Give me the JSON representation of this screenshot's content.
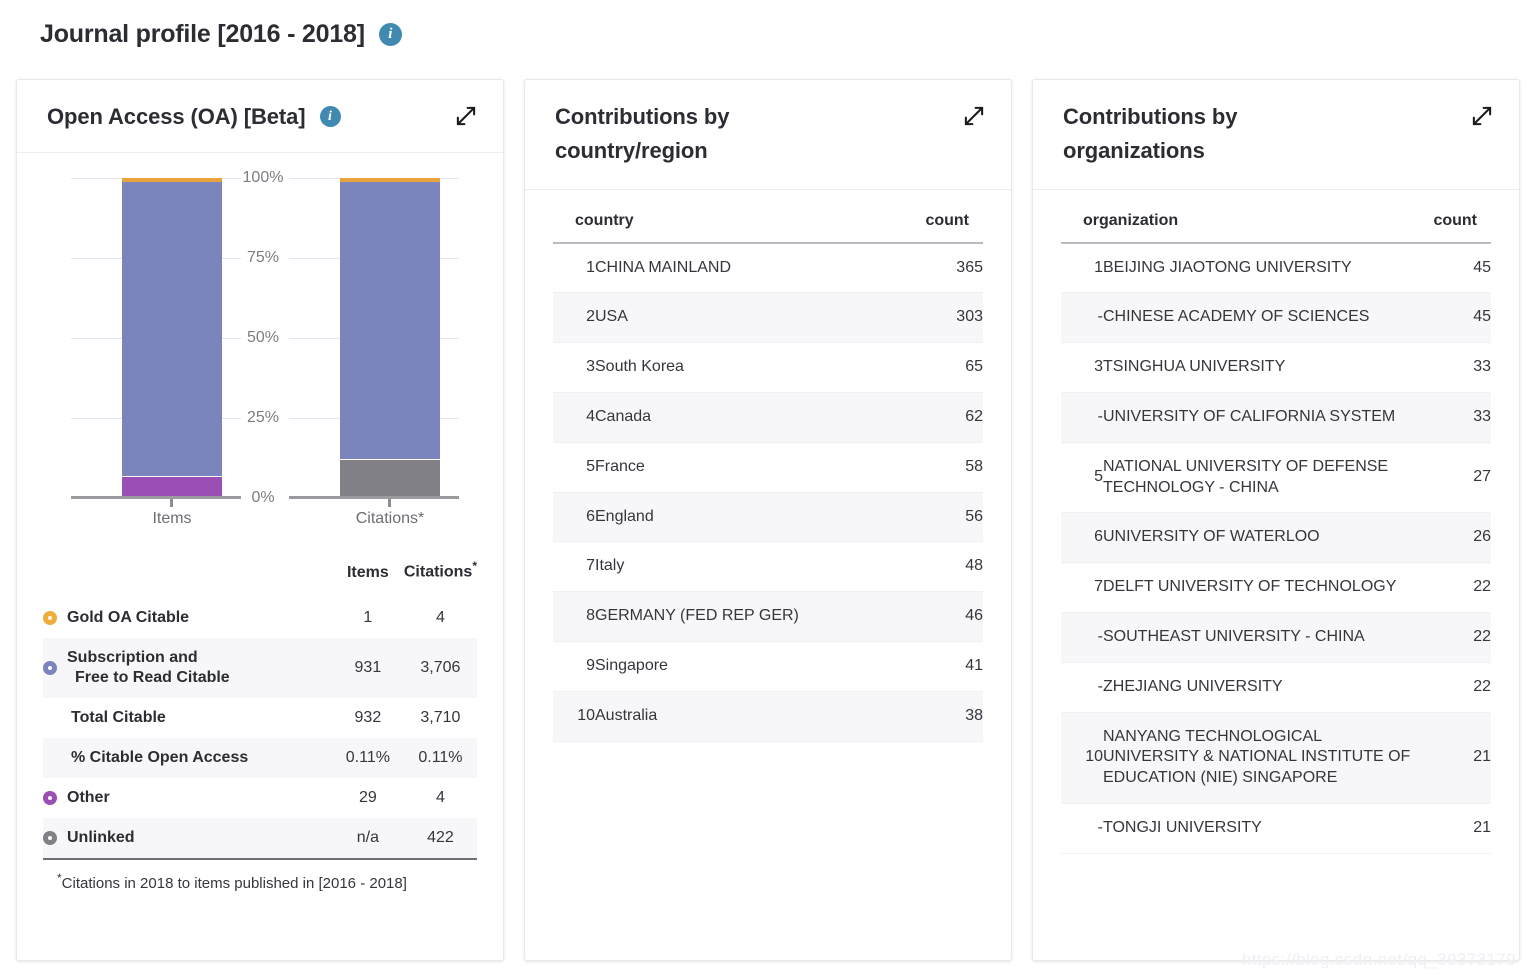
{
  "page": {
    "title": "Journal profile [2016 - 2018]",
    "info_icon": "info-icon",
    "watermark": "https://blog.csdn.net/qq_39373179"
  },
  "oa_panel": {
    "title": "Open Access (OA) [Beta]",
    "info_icon": "info-icon",
    "expand_icon": "expand-icon",
    "table": {
      "col_label": "",
      "col_items": "Items",
      "col_citations": "Citations",
      "citations_star": "*",
      "rows": [
        {
          "label": "Gold OA Citable",
          "label2": "",
          "items": "1",
          "citations": "4",
          "dot": "#f0ad3c",
          "indent": false,
          "alt": false
        },
        {
          "label": "Subscription and",
          "label2": "Free to Read Citable",
          "items": "931",
          "citations": "3,706",
          "dot": "#7b84bd",
          "indent": false,
          "alt": true
        },
        {
          "label": "Total Citable",
          "label2": "",
          "items": "932",
          "citations": "3,710",
          "dot": "",
          "indent": true,
          "alt": false
        },
        {
          "label": "% Citable Open Access",
          "label2": "",
          "items": "0.11%",
          "citations": "0.11%",
          "dot": "",
          "indent": true,
          "alt": true
        },
        {
          "label": "Other",
          "label2": "",
          "items": "29",
          "citations": "4",
          "dot": "#9b4fb5",
          "indent": false,
          "alt": false
        },
        {
          "label": "Unlinked",
          "label2": "",
          "items": "n/a",
          "citations": "422",
          "dot": "#808086",
          "indent": false,
          "alt": true
        }
      ]
    },
    "footnote_star": "*",
    "footnote": "Citations in 2018 to items published in [2016 - 2018]"
  },
  "chart_data": {
    "type": "bar",
    "title": "Open Access (OA) [Beta]",
    "stacked": true,
    "normalized_percent": true,
    "categories": [
      "Items",
      "Citations*"
    ],
    "xlabel": "",
    "ylabel": "",
    "ylim": [
      0,
      100
    ],
    "ytick_labels": [
      "0%",
      "25%",
      "50%",
      "75%",
      "100%"
    ],
    "ytick_values": [
      0,
      25,
      50,
      75,
      100
    ],
    "grid": true,
    "legend_position": "table-below",
    "series": [
      {
        "name": "Gold OA Citable",
        "color": "#f0ad3c",
        "values": [
          0.11,
          0.11
        ]
      },
      {
        "name": "Subscription and Free to Read Citable",
        "color": "#7b84bd",
        "values": [
          96.87,
          89.45
        ]
      },
      {
        "name": "Other",
        "color": "#9b4fb5",
        "values": [
          3.02,
          0.1
        ]
      },
      {
        "name": "Unlinked",
        "color": "#808086",
        "values": [
          0,
          10.34
        ]
      }
    ],
    "raw_counts": {
      "Items": {
        "Gold OA Citable": 1,
        "Subscription and Free to Read Citable": 931,
        "Total Citable": 932,
        "Other": 29,
        "Unlinked": "n/a"
      },
      "Citations": {
        "Gold OA Citable": 4,
        "Subscription and Free to Read Citable": 3706,
        "Total Citable": 3710,
        "Other": 4,
        "Unlinked": 422
      }
    }
  },
  "country_panel": {
    "title": "Contributions by country/region",
    "expand_icon": "expand-icon",
    "columns": {
      "name": "country",
      "count": "count"
    },
    "rows": [
      {
        "rank": "1",
        "name": "CHINA MAINLAND",
        "count": "365"
      },
      {
        "rank": "2",
        "name": "USA",
        "count": "303"
      },
      {
        "rank": "3",
        "name": "South Korea",
        "count": "65"
      },
      {
        "rank": "4",
        "name": "Canada",
        "count": "62"
      },
      {
        "rank": "5",
        "name": "France",
        "count": "58"
      },
      {
        "rank": "6",
        "name": "England",
        "count": "56"
      },
      {
        "rank": "7",
        "name": "Italy",
        "count": "48"
      },
      {
        "rank": "8",
        "name": "GERMANY (FED REP GER)",
        "count": "46"
      },
      {
        "rank": "9",
        "name": "Singapore",
        "count": "41"
      },
      {
        "rank": "10",
        "name": "Australia",
        "count": "38"
      }
    ]
  },
  "organization_panel": {
    "title": "Contributions by organizations",
    "expand_icon": "expand-icon",
    "columns": {
      "name": "organization",
      "count": "count"
    },
    "rows": [
      {
        "rank": "1",
        "name": "BEIJING JIAOTONG UNIVERSITY",
        "count": "45"
      },
      {
        "rank": "-",
        "name": "CHINESE ACADEMY OF SCIENCES",
        "count": "45"
      },
      {
        "rank": "3",
        "name": "TSINGHUA UNIVERSITY",
        "count": "33"
      },
      {
        "rank": "-",
        "name": "UNIVERSITY OF CALIFORNIA SYSTEM",
        "count": "33"
      },
      {
        "rank": "5",
        "name": "NATIONAL UNIVERSITY OF DEFENSE TECHNOLOGY - CHINA",
        "count": "27"
      },
      {
        "rank": "6",
        "name": "UNIVERSITY OF WATERLOO",
        "count": "26"
      },
      {
        "rank": "7",
        "name": "DELFT UNIVERSITY OF TECHNOLOGY",
        "count": "22"
      },
      {
        "rank": "-",
        "name": "SOUTHEAST UNIVERSITY - CHINA",
        "count": "22"
      },
      {
        "rank": "-",
        "name": "ZHEJIANG UNIVERSITY",
        "count": "22"
      },
      {
        "rank": "10",
        "name": "NANYANG TECHNOLOGICAL UNIVERSITY & NATIONAL INSTITUTE OF EDUCATION (NIE) SINGAPORE",
        "count": "21"
      },
      {
        "rank": "-",
        "name": "TONGJI UNIVERSITY",
        "count": "21"
      }
    ]
  }
}
